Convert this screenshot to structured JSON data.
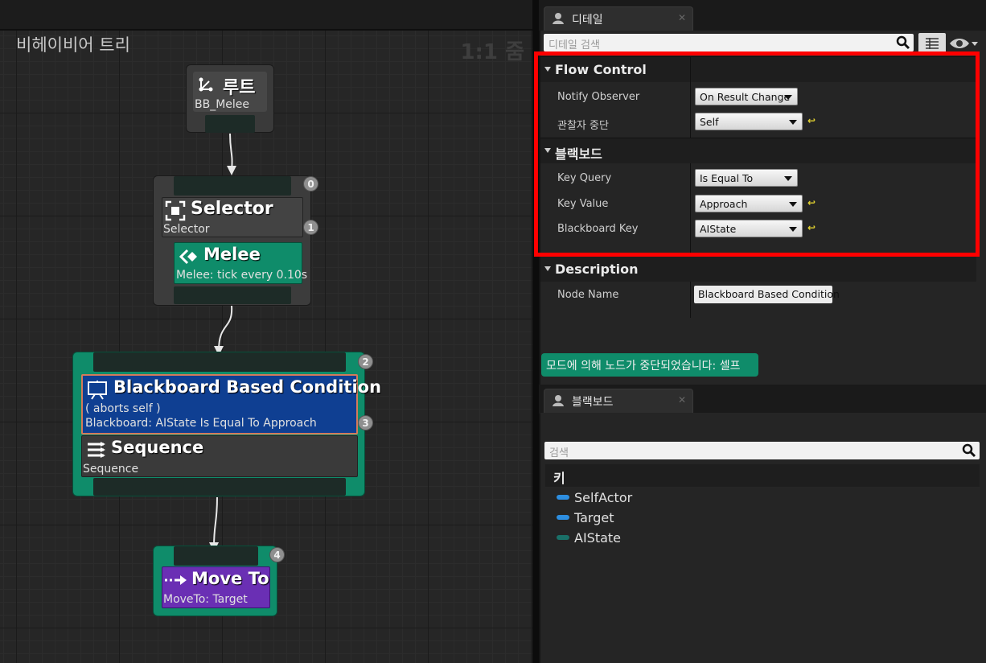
{
  "graph": {
    "title": "비헤이비어 트리",
    "zoom": "1:1 줌",
    "root": {
      "title": "루트",
      "subtitle": "BB_Melee"
    },
    "selector": {
      "title": "Selector",
      "subtitle": "Selector",
      "badge0": "0",
      "badge1": "1"
    },
    "melee": {
      "title": "Melee",
      "subtitle": "Melee: tick every 0.10s"
    },
    "bbcond": {
      "title": "Blackboard Based Condition",
      "line1": "( aborts self )",
      "line2": "Blackboard: AIState Is Equal To Approach",
      "badge2": "2",
      "badge3": "3"
    },
    "sequence": {
      "title": "Sequence",
      "subtitle": "Sequence"
    },
    "moveto": {
      "title": "Move To",
      "subtitle": "MoveTo: Target",
      "badge4": "4"
    }
  },
  "details": {
    "tab_label": "디테일",
    "search_placeholder": "디테일 검색",
    "flow_control": {
      "label": "Flow Control",
      "notify_observer_label": "Notify Observer",
      "notify_observer_value": "On Result Change",
      "observer_aborts_label": "관찰자 중단",
      "observer_aborts_value": "Self"
    },
    "blackboard": {
      "label": "블랙보드",
      "key_query_label": "Key Query",
      "key_query_value": "Is Equal To",
      "key_value_label": "Key Value",
      "key_value_value": "Approach",
      "bb_key_label": "Blackboard Key",
      "bb_key_value": "AIState"
    },
    "description": {
      "label": "Description",
      "node_name_label": "Node Name",
      "node_name_value": "Blackboard Based Condition"
    },
    "abort_message": "모드에 의해 노드가 중단되었습니다: 셀프"
  },
  "blackboard_panel": {
    "tab_label": "블랙보드",
    "search_placeholder": "검색",
    "keys_header": "키",
    "keys": [
      {
        "name": "SelfActor",
        "color": "#2d8ee0"
      },
      {
        "name": "Target",
        "color": "#2d8ee0"
      },
      {
        "name": "AIState",
        "color": "#1a7068"
      }
    ]
  },
  "colors": {
    "decorator_teal": "#0f8c6a",
    "condition_blue": "#0f3f92",
    "moveto_purple": "#6a2fb4",
    "highlight": "#ff0000"
  }
}
